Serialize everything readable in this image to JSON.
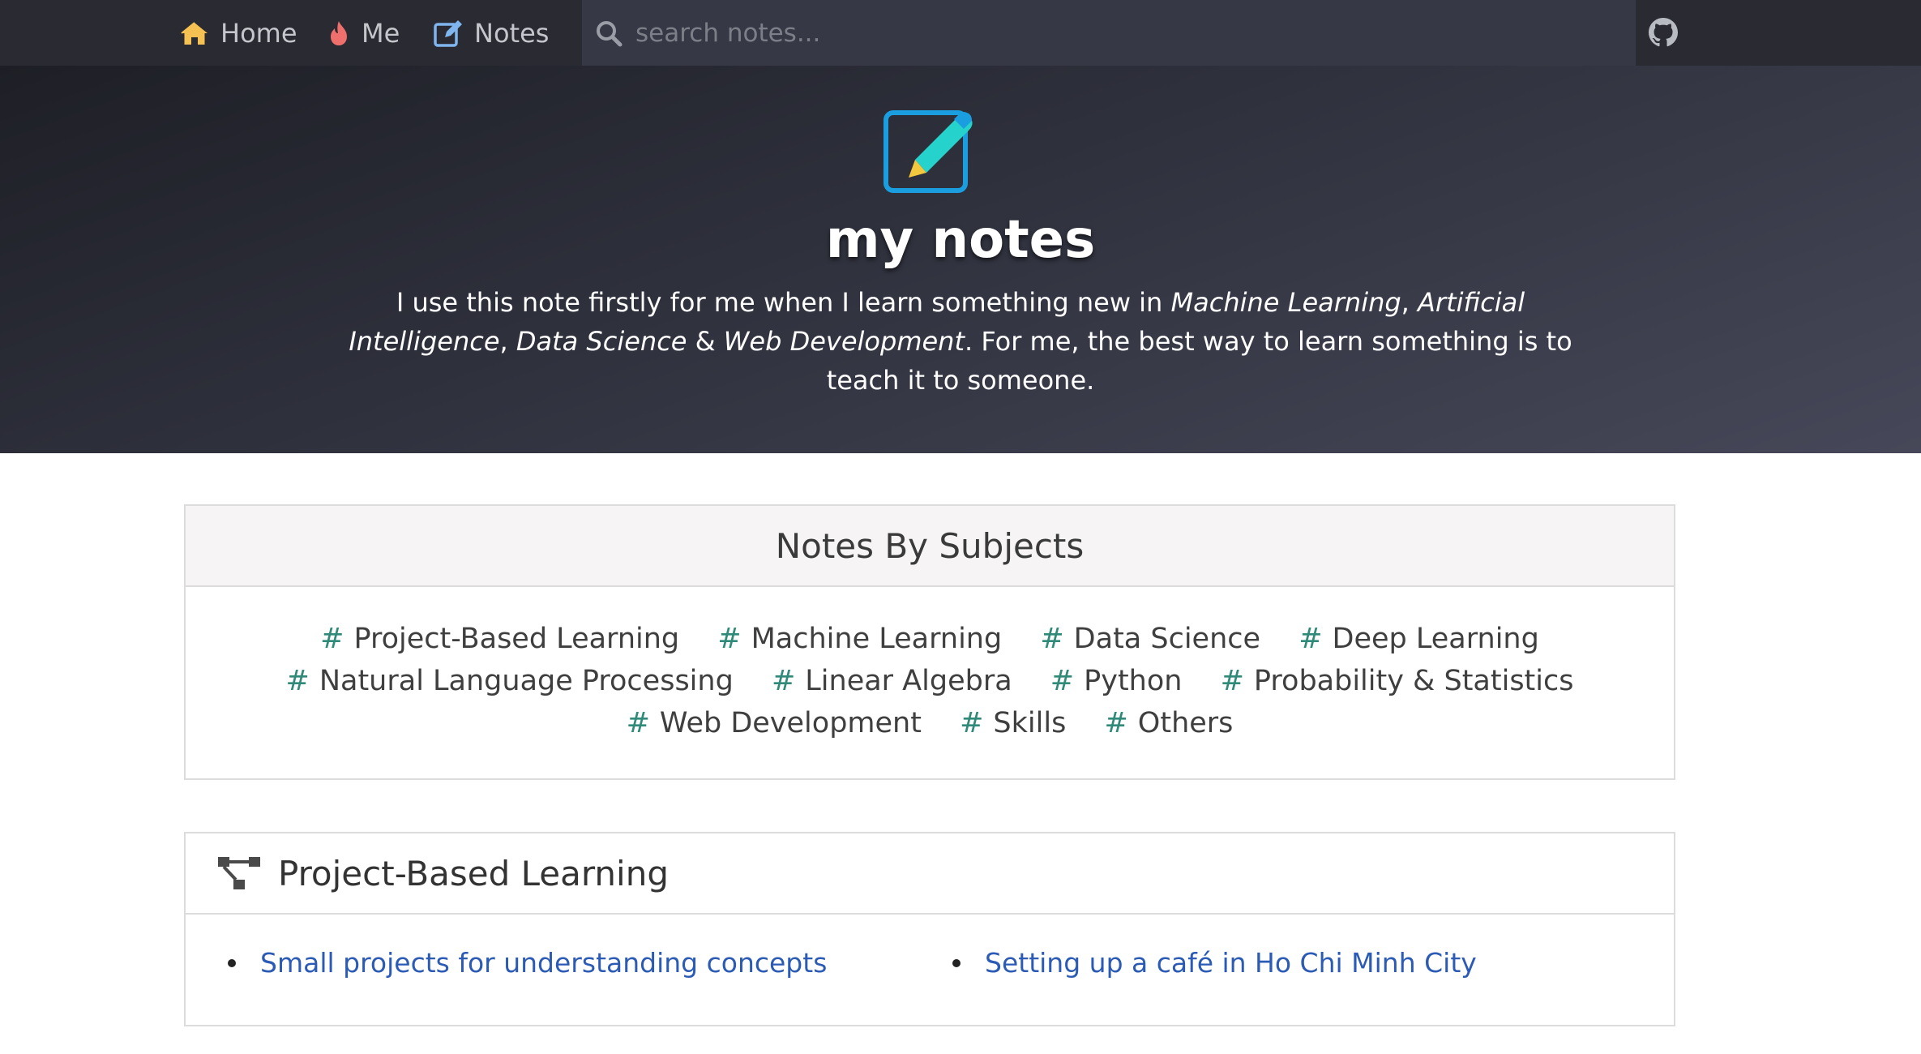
{
  "nav": {
    "home_label": "Home",
    "me_label": "Me",
    "notes_label": "Notes",
    "search_placeholder": "search notes...",
    "icons": [
      "home-icon",
      "fire-icon",
      "edit-icon",
      "search-icon",
      "github-icon"
    ]
  },
  "hero": {
    "title": "my notes",
    "desc_part1": "I use this note firstly for me when I learn something new in ",
    "desc_em1": "Machine Learning",
    "desc_sep1": ", ",
    "desc_em2": "Artificial Intelligence",
    "desc_sep2": ", ",
    "desc_em3": "Data Science",
    "desc_sep3": " & ",
    "desc_em4": "Web Development",
    "desc_part2": ". For me, the best way to learn something is to teach it to someone."
  },
  "subjects": {
    "title": "Notes By Subjects",
    "hash": "#",
    "tags": [
      "Project-Based Learning",
      "Machine Learning",
      "Data Science",
      "Deep Learning",
      "Natural Language Processing",
      "Linear Algebra",
      "Python",
      "Probability & Statistics",
      "Web Development",
      "Skills",
      "Others"
    ]
  },
  "project": {
    "title": "Project-Based Learning",
    "links": [
      "Small projects for understanding concepts",
      "Setting up a café in Ho Chi Minh City"
    ]
  },
  "colors": {
    "navbar": "#2a2a33",
    "search_bg": "#363845",
    "hash": "#2f8a7a",
    "link": "#2b5bb5",
    "logo_cyan": "#26d3cc",
    "logo_blue": "#1a9ee0"
  }
}
